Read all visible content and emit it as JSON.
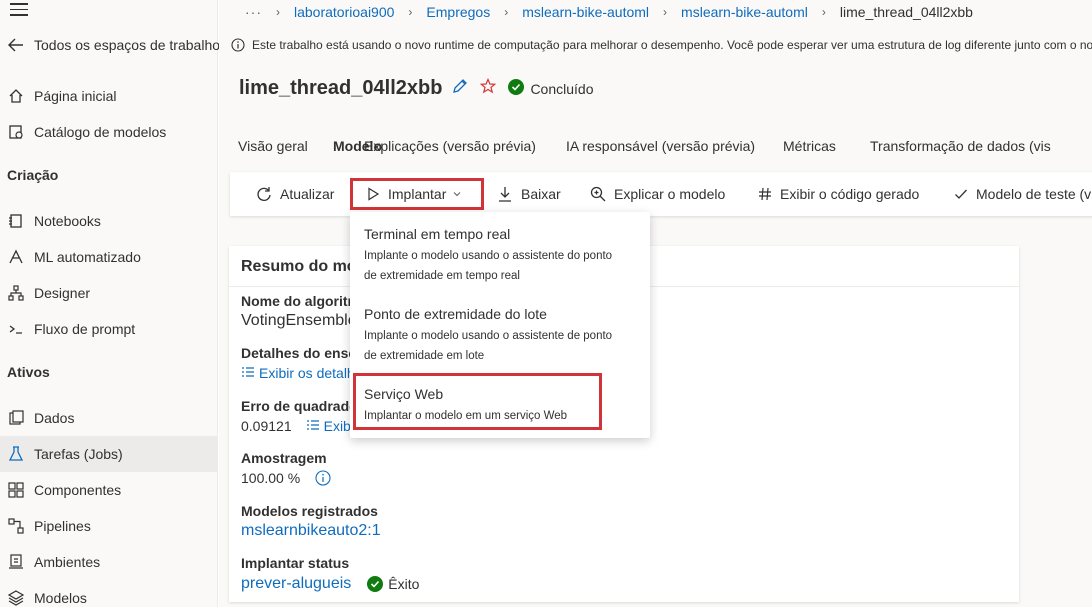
{
  "sidebar": {
    "back_label": "Todos os espaços de trabalho",
    "items_top": [
      {
        "label": "Página inicial",
        "icon": "home-icon"
      },
      {
        "label": "Catálogo de modelos",
        "icon": "catalog-icon"
      }
    ],
    "section_creation": "Criação",
    "items_creation": [
      {
        "label": "Notebooks",
        "icon": "notebook-icon"
      },
      {
        "label": "ML automatizado",
        "icon": "automl-icon"
      },
      {
        "label": "Designer",
        "icon": "designer-icon"
      },
      {
        "label": "Fluxo de prompt",
        "icon": "prompt-flow-icon"
      }
    ],
    "section_assets": "Ativos",
    "items_assets": [
      {
        "label": "Dados",
        "icon": "data-icon"
      },
      {
        "label": "Tarefas (Jobs)",
        "icon": "flask-icon"
      },
      {
        "label": "Componentes",
        "icon": "components-icon"
      },
      {
        "label": "Pipelines",
        "icon": "pipelines-icon"
      },
      {
        "label": "Ambientes",
        "icon": "environments-icon"
      },
      {
        "label": "Modelos",
        "icon": "models-icon"
      }
    ]
  },
  "breadcrumb": {
    "ellipsis": "···",
    "items": [
      "laboratorioai900",
      "Empregos",
      "mslearn-bike-automl",
      "mslearn-bike-automl",
      "lime_thread_04ll2xbb"
    ]
  },
  "infobar": {
    "text": "Este trabalho está usando o novo runtime de computação para melhorar o desempenho. Você pode esperar ver uma estrutura de log diferente junto com o no"
  },
  "header": {
    "title": "lime_thread_04ll2xbb",
    "status": "Concluído"
  },
  "tabs": [
    "Visão geral",
    "Modelo",
    "Explicações (versão prévia)",
    "IA responsável (versão prévia)",
    "Métricas",
    "Transformação de dados (vis"
  ],
  "toolbar": {
    "refresh": "Atualizar",
    "deploy": "Implantar",
    "download": "Baixar",
    "explain": "Explicar o modelo",
    "view_code": "Exibir o código gerado",
    "test_model": "Modelo de teste (v"
  },
  "panel": {
    "title": "Resumo do mo",
    "algorithm_label": "Nome do algoritr",
    "algorithm_value": "VotingEnsemble",
    "ensemble_label": "Detalhes do ense",
    "ensemble_link": "Exibir os detalh",
    "error_label": "Erro de quadrado",
    "error_value": "0.09121",
    "error_link": "Exib",
    "sampling_label": "Amostragem",
    "sampling_value": "100.00 %",
    "registered_label": "Modelos registrados",
    "registered_value": "mslearnbikeauto2:1",
    "deploy_status_label": "Implantar status",
    "deploy_status_link": "prever-alugueis",
    "deploy_status_value": "Êxito"
  },
  "menu": {
    "items": [
      {
        "title": "Terminal em tempo real",
        "desc_line1": "Implante o modelo usando o assistente do ponto",
        "desc_line2": "de extremidade em tempo real"
      },
      {
        "title": "Ponto de extremidade do lote",
        "desc_line1": "Implante o modelo usando o assistente de ponto",
        "desc_line2": "de extremidade em lote"
      },
      {
        "title": "Serviço Web",
        "desc_line1": "Implantar o modelo em um serviço Web"
      }
    ]
  },
  "colors": {
    "accent": "#0f6cbd",
    "success": "#107c10",
    "highlight": "#d13438",
    "favorite": "#d13438"
  }
}
